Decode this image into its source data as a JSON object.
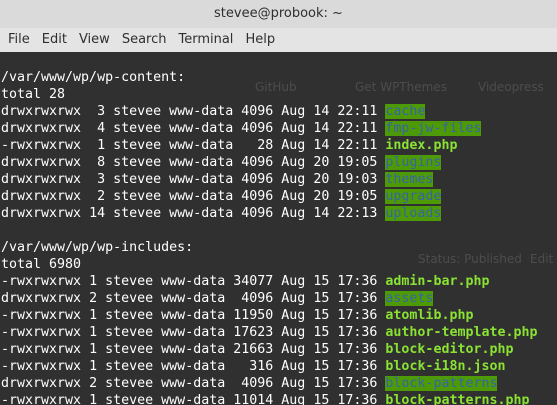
{
  "window": {
    "title": "stevee@probook: ~"
  },
  "menu": [
    "File",
    "Edit",
    "View",
    "Search",
    "Terminal",
    "Help"
  ],
  "background_ghost": {
    "tab_labels": [
      "GitHub",
      "Get WPThemes",
      "Videopress"
    ],
    "status_text": "Status: Published",
    "status_link": "Edit"
  },
  "sections": [
    {
      "heading": "/var/www/wp/wp-content:",
      "total": "total 28",
      "entries": [
        {
          "perms": "drwxrwxrwx",
          "links": "3",
          "owner": "stevee",
          "group": "www-data",
          "size": "4096",
          "month": "Aug",
          "day": "14",
          "time": "22:11",
          "name": "cache",
          "kind": "dir"
        },
        {
          "perms": "drwxrwxrwx",
          "links": "4",
          "owner": "stevee",
          "group": "www-data",
          "size": "4096",
          "month": "Aug",
          "day": "14",
          "time": "22:11",
          "name": "fmp-jw-files",
          "kind": "dir"
        },
        {
          "perms": "-rwxrwxrwx",
          "links": "1",
          "owner": "stevee",
          "group": "www-data",
          "size": "28",
          "month": "Aug",
          "day": "14",
          "time": "22:11",
          "name": "index.php",
          "kind": "exec"
        },
        {
          "perms": "drwxrwxrwx",
          "links": "8",
          "owner": "stevee",
          "group": "www-data",
          "size": "4096",
          "month": "Aug",
          "day": "20",
          "time": "19:05",
          "name": "plugins",
          "kind": "dir"
        },
        {
          "perms": "drwxrwxrwx",
          "links": "3",
          "owner": "stevee",
          "group": "www-data",
          "size": "4096",
          "month": "Aug",
          "day": "20",
          "time": "19:03",
          "name": "themes",
          "kind": "dir"
        },
        {
          "perms": "drwxrwxrwx",
          "links": "2",
          "owner": "stevee",
          "group": "www-data",
          "size": "4096",
          "month": "Aug",
          "day": "20",
          "time": "19:05",
          "name": "upgrade",
          "kind": "dir"
        },
        {
          "perms": "drwxrwxrwx",
          "links": "14",
          "owner": "stevee",
          "group": "www-data",
          "size": "4096",
          "month": "Aug",
          "day": "14",
          "time": "22:13",
          "name": "uploads",
          "kind": "dir"
        }
      ]
    },
    {
      "heading": "/var/www/wp/wp-includes:",
      "total": "total 6980",
      "entries": [
        {
          "perms": "-rwxrwxrwx",
          "links": "1",
          "owner": "stevee",
          "group": "www-data",
          "size": "34077",
          "month": "Aug",
          "day": "15",
          "time": "17:36",
          "name": "admin-bar.php",
          "kind": "exec"
        },
        {
          "perms": "drwxrwxrwx",
          "links": "2",
          "owner": "stevee",
          "group": "www-data",
          "size": "4096",
          "month": "Aug",
          "day": "15",
          "time": "17:36",
          "name": "assets",
          "kind": "dir"
        },
        {
          "perms": "-rwxrwxrwx",
          "links": "1",
          "owner": "stevee",
          "group": "www-data",
          "size": "11950",
          "month": "Aug",
          "day": "15",
          "time": "17:36",
          "name": "atomlib.php",
          "kind": "exec"
        },
        {
          "perms": "-rwxrwxrwx",
          "links": "1",
          "owner": "stevee",
          "group": "www-data",
          "size": "17623",
          "month": "Aug",
          "day": "15",
          "time": "17:36",
          "name": "author-template.php",
          "kind": "exec"
        },
        {
          "perms": "-rwxrwxrwx",
          "links": "1",
          "owner": "stevee",
          "group": "www-data",
          "size": "21663",
          "month": "Aug",
          "day": "15",
          "time": "17:36",
          "name": "block-editor.php",
          "kind": "exec"
        },
        {
          "perms": "-rwxrwxrwx",
          "links": "1",
          "owner": "stevee",
          "group": "www-data",
          "size": "316",
          "month": "Aug",
          "day": "15",
          "time": "17:36",
          "name": "block-i18n.json",
          "kind": "exec"
        },
        {
          "perms": "drwxrwxrwx",
          "links": "2",
          "owner": "stevee",
          "group": "www-data",
          "size": "4096",
          "month": "Aug",
          "day": "15",
          "time": "17:36",
          "name": "block-patterns",
          "kind": "dir"
        },
        {
          "perms": "-rwxrwxrwx",
          "links": "1",
          "owner": "stevee",
          "group": "www-data",
          "size": "11014",
          "month": "Aug",
          "day": "15",
          "time": "17:36",
          "name": "block-patterns.php",
          "kind": "exec"
        }
      ]
    }
  ],
  "colors": {
    "dir_bg": "#4e9a06",
    "dir_fg": "#3465a4",
    "exec_fg": "#8ae234",
    "text": "#ffffff",
    "terminal_bg": "#303030"
  }
}
